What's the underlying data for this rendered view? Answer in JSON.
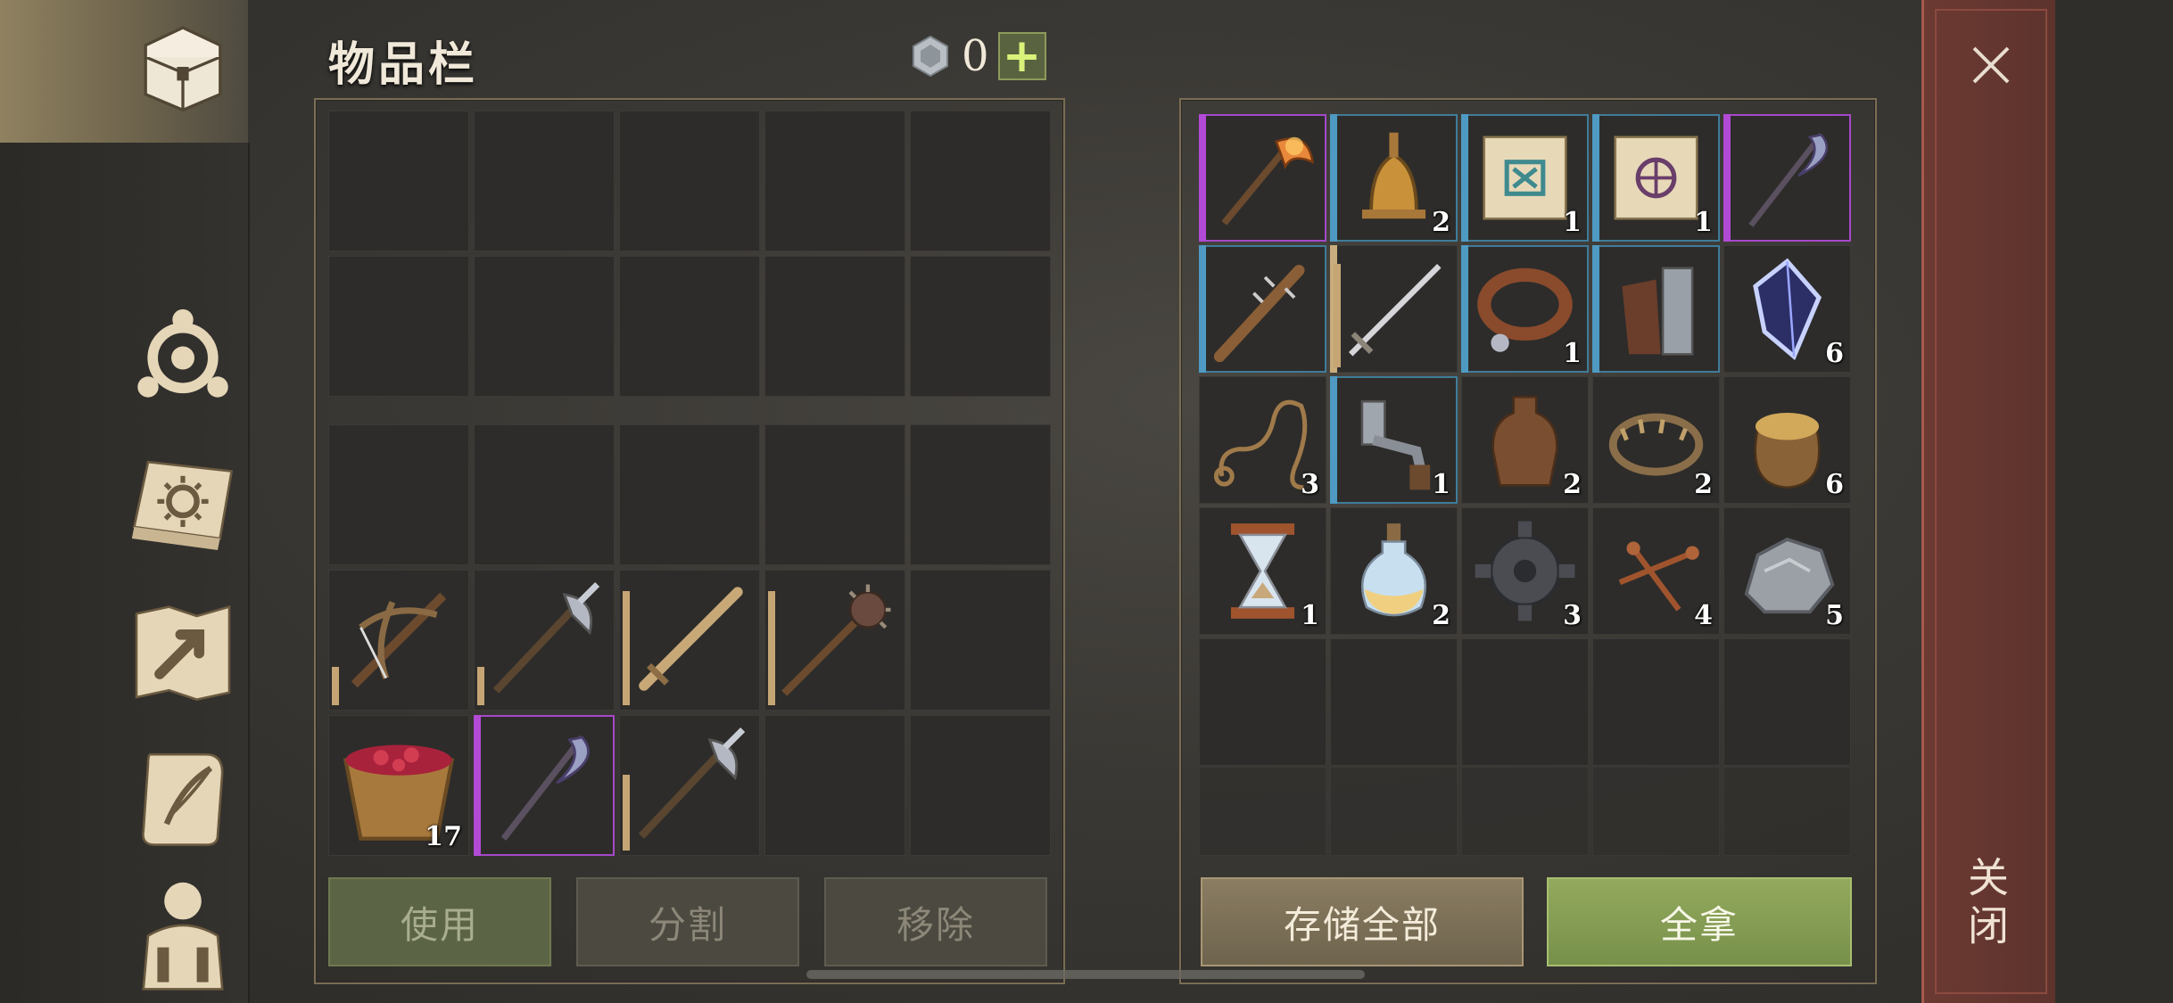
{
  "header": {
    "title": "物品栏",
    "currency_value": "0",
    "plus_label": "+"
  },
  "sidebar": {
    "icons": [
      "chest-icon",
      "compass-icon",
      "sun-book-icon",
      "map-arrow-icon",
      "scroll-quill-icon",
      "character-backpack-icon"
    ]
  },
  "left_panel": {
    "top_grid_rows": 2,
    "bottom_grid": [
      {
        "item": "",
        "count": ""
      },
      {
        "item": "",
        "count": ""
      },
      {
        "item": "",
        "count": ""
      },
      {
        "item": "",
        "count": ""
      },
      {
        "item": "",
        "count": ""
      },
      {
        "item": "crossbow-icon",
        "rarity": "none",
        "durability": 0.3,
        "count": ""
      },
      {
        "item": "halberd-icon",
        "rarity": "none",
        "durability": 0.3,
        "count": ""
      },
      {
        "item": "sword-icon",
        "rarity": "none",
        "durability": 0.9,
        "count": ""
      },
      {
        "item": "mace-icon",
        "rarity": "none",
        "durability": 0.9,
        "count": ""
      },
      {
        "item": "",
        "count": ""
      },
      {
        "item": "berry-bucket-icon",
        "rarity": "none",
        "count": "17"
      },
      {
        "item": "scythe-icon",
        "rarity": "purple",
        "durability": 0.9,
        "count": ""
      },
      {
        "item": "halberd-icon",
        "rarity": "none",
        "durability": 0.6,
        "count": ""
      },
      {
        "item": "",
        "count": ""
      },
      {
        "item": "",
        "count": ""
      }
    ]
  },
  "right_panel": {
    "items": [
      {
        "item": "fire-axe-icon",
        "rarity": "purple",
        "count": ""
      },
      {
        "item": "bell-icon",
        "rarity": "blue",
        "count": "2"
      },
      {
        "item": "blue-scroll-icon",
        "rarity": "blue",
        "count": "1"
      },
      {
        "item": "purple-scroll-icon",
        "rarity": "blue",
        "count": "1"
      },
      {
        "item": "scythe-icon",
        "rarity": "purple",
        "count": ""
      },
      {
        "item": "spiked-club-icon",
        "rarity": "blue",
        "durability": 0.9,
        "count": ""
      },
      {
        "item": "longsword-icon",
        "rarity": "tan",
        "durability": 0.9,
        "count": ""
      },
      {
        "item": "collar-icon",
        "rarity": "blue",
        "count": "1"
      },
      {
        "item": "gauntlet-icon",
        "rarity": "blue",
        "durability": 0.9,
        "count": ""
      },
      {
        "item": "crystal-icon",
        "rarity": "none",
        "count": "6"
      },
      {
        "item": "rope-icon",
        "rarity": "none",
        "count": "3"
      },
      {
        "item": "crank-icon",
        "rarity": "blue",
        "count": "1"
      },
      {
        "item": "leather-flask-icon",
        "rarity": "none",
        "count": "2"
      },
      {
        "item": "bear-trap-icon",
        "rarity": "none",
        "count": "2"
      },
      {
        "item": "grain-sack-icon",
        "rarity": "none",
        "count": "6"
      },
      {
        "item": "hourglass-icon",
        "rarity": "none",
        "count": "1"
      },
      {
        "item": "potion-icon",
        "rarity": "none",
        "count": "2"
      },
      {
        "item": "gear-icon",
        "rarity": "none",
        "count": "3"
      },
      {
        "item": "nails-icon",
        "rarity": "none",
        "count": "4"
      },
      {
        "item": "stone-icon",
        "rarity": "none",
        "count": "5"
      }
    ]
  },
  "buttons": {
    "use": "使用",
    "split": "分割",
    "remove": "移除",
    "store_all": "存储全部",
    "take_all": "全拿"
  },
  "close": {
    "label": "关闭"
  },
  "colors": {
    "rarity_purple": "#b24ad6",
    "rarity_blue": "#4e9ac2",
    "take_all_green": "#93aa5d",
    "close_red": "#6b3a32"
  }
}
